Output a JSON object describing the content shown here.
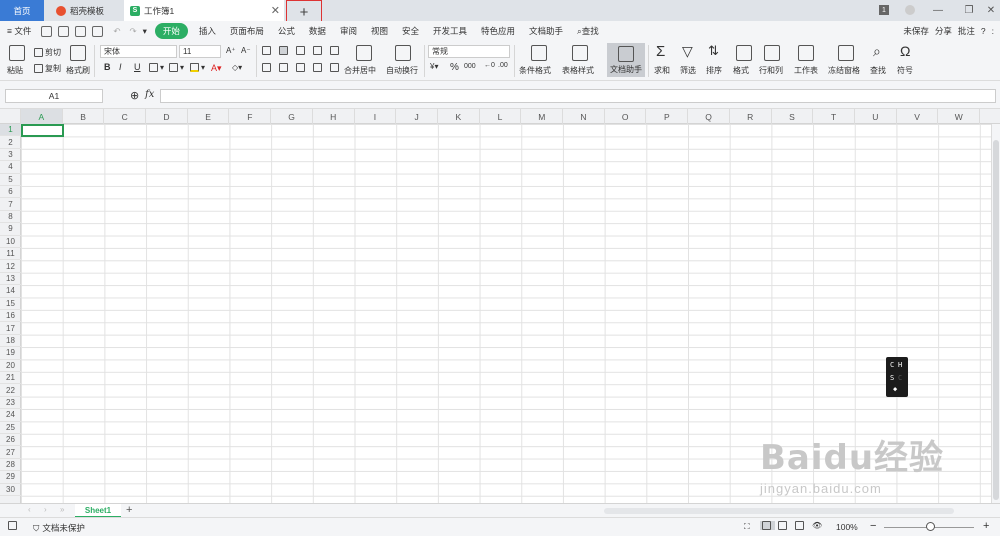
{
  "titlebar": {
    "tabs": [
      "首页",
      "稻壳模板",
      "工作簿1"
    ],
    "new_tab": "+",
    "close": "✕",
    "window_num": "1",
    "minimize": "—",
    "restore": "❐",
    "close_window": "✕"
  },
  "menubar": {
    "file": "≡ 文件",
    "items": [
      "开始",
      "插入",
      "页面布局",
      "公式",
      "数据",
      "审阅",
      "视图",
      "安全",
      "开发工具",
      "特色应用",
      "文档助手"
    ],
    "search": "查找",
    "right": [
      "未保存",
      "分享",
      "批注",
      "?",
      ":"
    ]
  },
  "ribbon": {
    "paste": "粘贴",
    "cut": "剪切",
    "copy": "复制",
    "format_painter": "格式刷",
    "font_name": "宋体",
    "font_size": "11",
    "grow": "A⁺",
    "shrink": "A⁻",
    "bold": "B",
    "italic": "I",
    "underline": "U",
    "merge_center": "合并居中",
    "wrap_text": "自动换行",
    "number_format": "常规",
    "percent": "%",
    "thousands": "000",
    "cond_format": "条件格式",
    "table_style": "表格样式",
    "doc_assist": "文档助手",
    "sum": "求和",
    "filter": "筛选",
    "sort": "排序",
    "format": "格式",
    "rowcol": "行和列",
    "worksheet": "工作表",
    "freeze": "冻结窗格",
    "find": "查找",
    "symbol": "符号"
  },
  "formulabar": {
    "cell_ref": "A1",
    "fx": "fx",
    "zoom_icon": "⊕"
  },
  "grid": {
    "columns": [
      "A",
      "B",
      "C",
      "D",
      "E",
      "F",
      "G",
      "H",
      "I",
      "J",
      "K",
      "L",
      "M",
      "N",
      "O",
      "P",
      "Q",
      "R",
      "S",
      "T",
      "U",
      "V",
      "W"
    ],
    "rows": [
      "1",
      "2",
      "3",
      "4",
      "5",
      "6",
      "7",
      "8",
      "9",
      "10",
      "11",
      "12",
      "13",
      "14",
      "15",
      "16",
      "17",
      "18",
      "19",
      "20",
      "21",
      "22",
      "23",
      "24",
      "25",
      "26",
      "27",
      "28",
      "29",
      "30"
    ]
  },
  "ime": {
    "c": "C",
    "h": "H",
    "s": "S",
    "c2": "C"
  },
  "sheetbar": {
    "sheet": "Sheet1",
    "add": "+"
  },
  "statusbar": {
    "protect": "文档未保护",
    "zoom": "100%",
    "minus": "−",
    "plus": "+"
  },
  "watermark": {
    "logo": "Baidu经验",
    "url": "jingyan.baidu.com"
  },
  "colors": {
    "accent": "#2cae64",
    "home_tab": "#3a7bd5",
    "highlight_box": "#dd3333"
  }
}
